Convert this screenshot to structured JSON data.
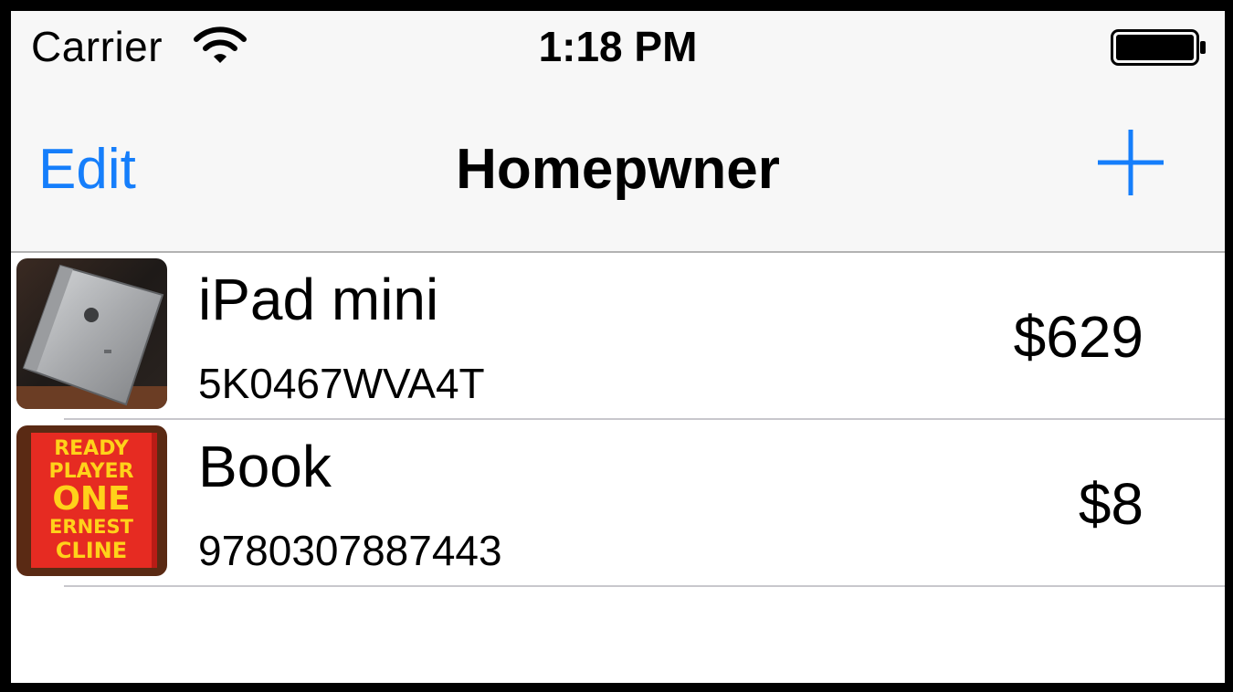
{
  "status_bar": {
    "carrier": "Carrier",
    "time": "1:18 PM",
    "wifi_icon": "wifi-icon",
    "battery_icon": "battery-icon"
  },
  "nav_bar": {
    "edit_label": "Edit",
    "title": "Homepwner",
    "add_icon": "plus-icon",
    "tint_color": "#157efb"
  },
  "items": [
    {
      "name": "iPad mini",
      "serial": "5K0467WVA4T",
      "value": "$629",
      "thumbnail": "ipad-photo"
    },
    {
      "name": "Book",
      "serial": "9780307887443",
      "value": "$8",
      "thumbnail": "book-cover-photo",
      "cover_text": [
        "READY",
        "PLAYER",
        "ONE",
        "ERNEST",
        "CLINE"
      ]
    }
  ]
}
